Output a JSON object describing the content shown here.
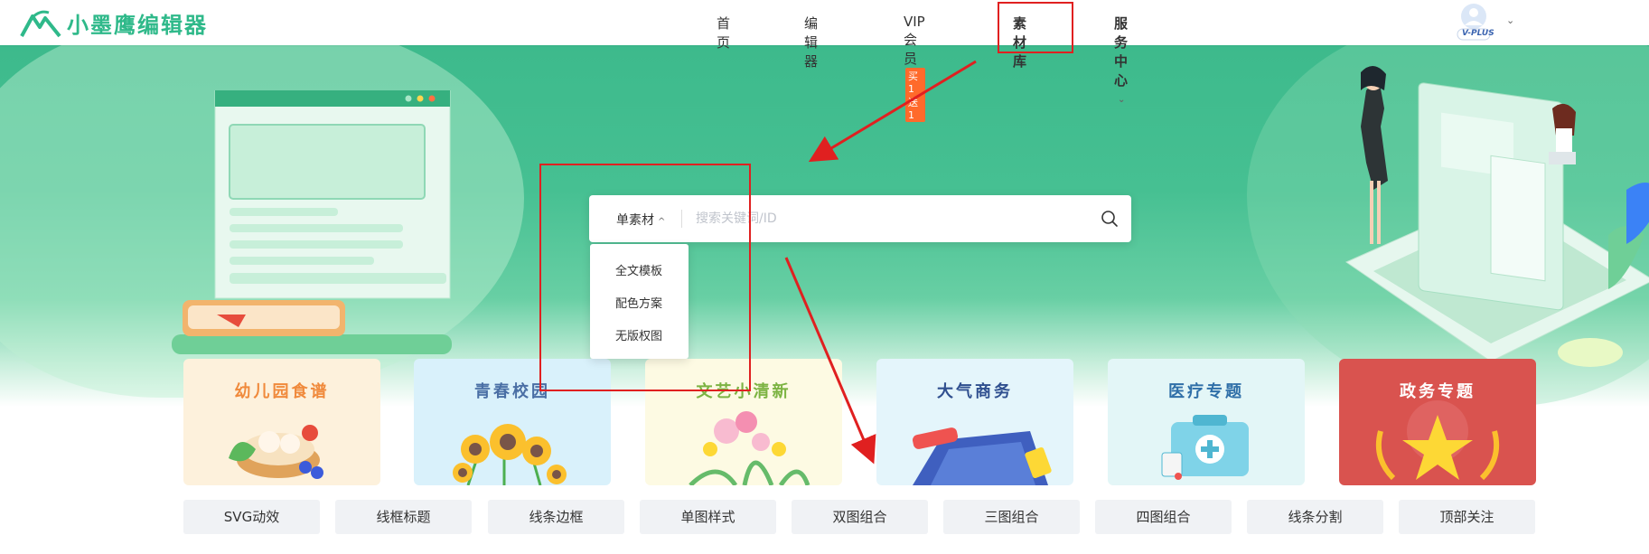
{
  "header": {
    "logo_text": "小墨鹰编辑器",
    "nav": {
      "home": "首页",
      "editor": "编辑器",
      "vip": "VIP会员",
      "vip_badge": "买1送1",
      "materials": "素材库",
      "service": "服务中心"
    },
    "avatar_label": "V-PLUS"
  },
  "search": {
    "type_label": "单素材",
    "placeholder": "搜索关键词/ID",
    "dropdown": [
      "全文模板",
      "配色方案",
      "无版权图"
    ]
  },
  "cards": [
    {
      "title": "幼儿园食谱",
      "color": "#f08a3c",
      "bg": "#fdf1dc"
    },
    {
      "title": "青春校园",
      "color": "#4a6fa5",
      "bg": "#d9f1fb"
    },
    {
      "title": "文艺小清新",
      "color": "#7cb342",
      "bg": "#fdfae3"
    },
    {
      "title": "大气商务",
      "color": "#2f4f8f",
      "bg": "#e4f5fb"
    },
    {
      "title": "医疗专题",
      "color": "#2f6fa8",
      "bg": "#e3f6f7"
    },
    {
      "title": "政务专题",
      "color": "#ffffff",
      "bg": "#d9534f"
    }
  ],
  "tags": [
    "SVG动效",
    "线框标题",
    "线条边框",
    "单图样式",
    "双图组合",
    "三图组合",
    "四图组合",
    "线条分割",
    "顶部关注"
  ],
  "colors": {
    "brand": "#2fb98a",
    "annotation": "#e02020"
  }
}
